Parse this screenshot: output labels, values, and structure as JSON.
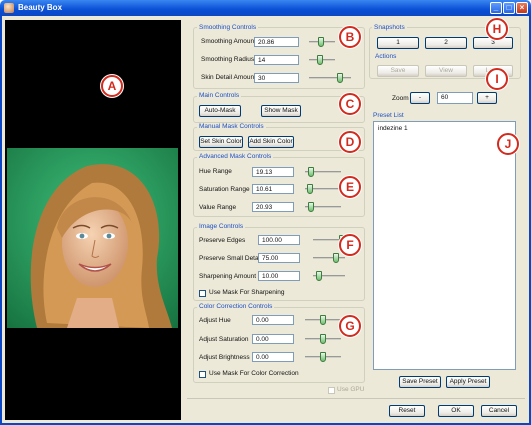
{
  "window": {
    "title": "Beauty Box"
  },
  "markers": [
    "A",
    "B",
    "C",
    "D",
    "E",
    "F",
    "G",
    "H",
    "I",
    "J"
  ],
  "smoothing": {
    "title": "Smoothing Controls",
    "amount_label": "Smoothing Amount",
    "amount_value": "20.86",
    "amount_level": 0.45,
    "radius_label": "Smoothing Radius",
    "radius_value": "14",
    "radius_level": 0.4,
    "detail_label": "Skin Detail Amount",
    "detail_value": "30",
    "detail_level": 0.78
  },
  "main_controls": {
    "title": "Main Controls",
    "auto_mask": "Auto-Mask",
    "show_mask": "Show Mask"
  },
  "manual_mask": {
    "title": "Manual Mask Controls",
    "set_skin": "Set Skin Color",
    "add_skin": "Add Skin Color"
  },
  "advanced_mask": {
    "title": "Advanced Mask Controls",
    "hue_label": "Hue Range",
    "hue_value": "19.13",
    "hue_level": 0.1,
    "sat_label": "Saturation Range",
    "sat_value": "10.61",
    "sat_level": 0.05,
    "val_label": "Value Range",
    "val_value": "20.93",
    "val_level": 0.1
  },
  "image_controls": {
    "title": "Image Controls",
    "edges_label": "Preserve Edges",
    "edges_value": "100.00",
    "edges_level": 1.0,
    "small_label": "Preserve Small Detail",
    "small_value": "75.00",
    "small_level": 0.75,
    "sharp_label": "Sharpening Amount",
    "sharp_value": "10.00",
    "sharp_level": 0.1,
    "use_mask_sharp": "Use Mask For Sharpening"
  },
  "color_correction": {
    "title": "Color Correction Controls",
    "hue_label": "Adjust Hue",
    "hue_value": "0.00",
    "hue_level": 0.5,
    "sat_label": "Adjust Saturation",
    "sat_value": "0.00",
    "sat_level": 0.5,
    "bri_label": "Adjust Brightness",
    "bri_value": "0.00",
    "bri_level": 0.5,
    "use_mask_cc": "Use Mask For Color Correction",
    "use_gpu": "Use GPU"
  },
  "snapshots": {
    "title": "Snapshots",
    "buttons": [
      "1",
      "2",
      "3"
    ]
  },
  "actions": {
    "title": "Actions",
    "save": "Save",
    "view": "View",
    "load": "Load"
  },
  "zoom": {
    "label": "Zoom",
    "minus": "-",
    "value": "60",
    "plus": "+"
  },
  "presets": {
    "title": "Preset List",
    "items": [
      "indezine 1"
    ],
    "save_preset": "Save Preset",
    "apply_preset": "Apply Preset"
  },
  "footer": {
    "reset": "Reset",
    "ok": "OK",
    "cancel": "Cancel"
  },
  "colors": {
    "accent": "#1d4fc5",
    "marker": "#d32a1e",
    "titlebar": "#0a4fd6",
    "thumb": "#6fbf6f"
  }
}
